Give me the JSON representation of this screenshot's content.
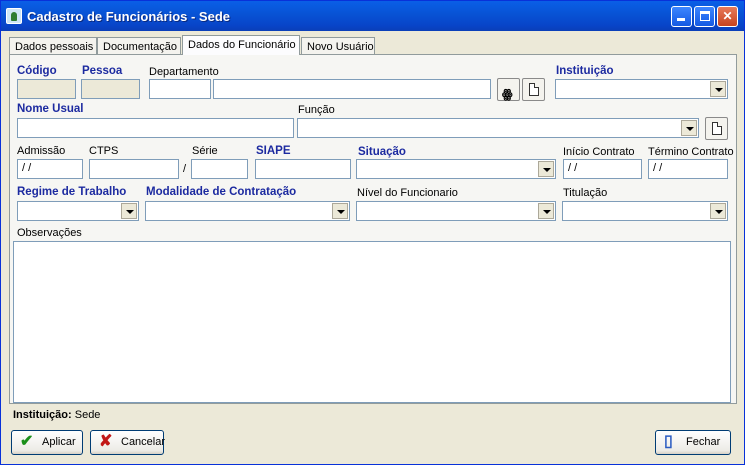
{
  "window": {
    "title": "Cadastro de Funcionários - Sede"
  },
  "tabs": [
    {
      "label": "Dados pessoais"
    },
    {
      "label": "Documentação"
    },
    {
      "label": "Dados do Funcionário",
      "active": true
    },
    {
      "label": "Novo Usuário"
    }
  ],
  "form": {
    "codigo_label": "Código",
    "pessoa_label": "Pessoa",
    "departamento_label": "Departamento",
    "instituicao_label": "Instituição",
    "nome_usual_label": "Nome Usual",
    "funcao_label": "Função",
    "admissao_label": "Admissão",
    "admissao_value": " / /",
    "ctps_label": "CTPS",
    "ctps_sep": "/",
    "serie_label": "Série",
    "siape_label": "SIAPE",
    "situacao_label": "Situação",
    "inicio_contrato_label": "Início Contrato",
    "inicio_contrato_value": " / /",
    "termino_contrato_label": "Término Contrato",
    "termino_contrato_value": " / /",
    "regime_label": "Regime de Trabalho",
    "modalidade_label": "Modalidade de Contratação",
    "nivel_label": "Nível do Funcionario",
    "titulacao_label": "Titulação",
    "observacoes_label": "Observações"
  },
  "status": {
    "label": "Instituição:",
    "value": "Sede"
  },
  "buttons": {
    "aplicar": "Aplicar",
    "cancelar": "Cancelar",
    "fechar": "Fechar"
  },
  "icons": {
    "search": "binoculars-icon",
    "new": "new-document-icon"
  },
  "colors": {
    "label_bold": "#1c2aa0",
    "titlebar": "#0852d4"
  }
}
